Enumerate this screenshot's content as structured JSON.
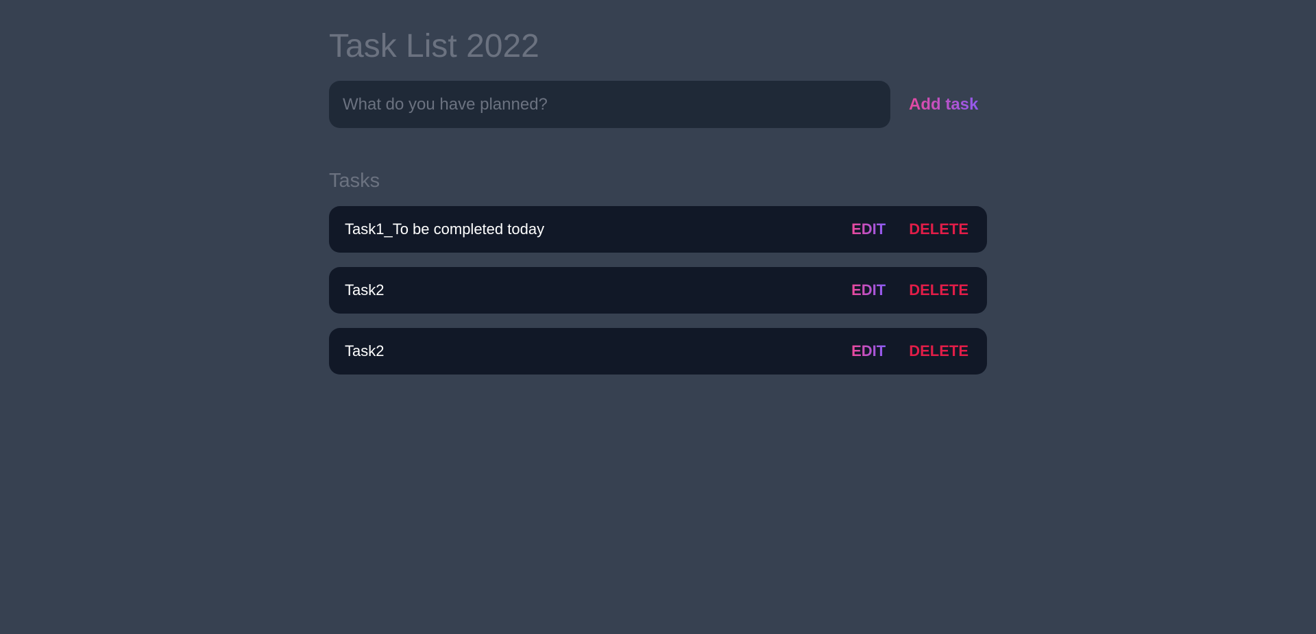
{
  "header": {
    "title": "Task List 2022"
  },
  "add_form": {
    "placeholder": "What do you have planned?",
    "value": "",
    "add_label": "Add task"
  },
  "tasks_section": {
    "title": "Tasks",
    "items": [
      {
        "text": "Task1_To be completed today",
        "edit_label": "EDIT",
        "delete_label": "DELETE"
      },
      {
        "text": "Task2",
        "edit_label": "EDIT",
        "delete_label": "DELETE"
      },
      {
        "text": "Task2",
        "edit_label": "EDIT",
        "delete_label": "DELETE"
      }
    ]
  },
  "colors": {
    "background": "#374151",
    "input_background": "#1f2937",
    "task_background": "#111827",
    "accent_gradient_start": "#ec4899",
    "accent_gradient_end": "#8b5cf6",
    "delete": "#e11d48",
    "muted_text": "#6b7280"
  }
}
